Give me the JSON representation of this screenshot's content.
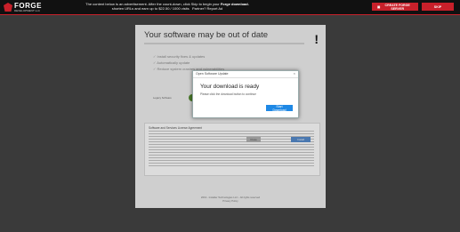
{
  "topbar": {
    "logo_main": "FORGE",
    "logo_sub": "DEVELOPMENT LLC",
    "ad_line1_pre": "The content below is an advertisement. After the count-down, click Skip to begin your ",
    "ad_line1_bold": "Forge download.",
    "ad_line2": "shorten URLs and earn up to $22.50 / 1000 visits",
    "ad_line2_right": "Partner? Report Ad",
    "create_label": "CREATE FORGE SERVER",
    "skip_label": "SKIP"
  },
  "page": {
    "title": "Your software may be out of date",
    "bullets": [
      "Install security fixes & updates",
      "Automatically update",
      "Reduce system crashes and vulnerabilities"
    ],
    "legacy_label": "Legacy Software",
    "license_title": "Software and Services License Agreement",
    "close_label": "Close",
    "install_label": "Install",
    "footer_line1": "2019 - Installer Technologies LLC - All rights reserved",
    "footer_line2": "Privacy Policy"
  },
  "modal": {
    "title": "Open Software Update",
    "close": "×",
    "heading": "Your download is ready",
    "text": "Please click the download button to continue",
    "start_label": "Start Download"
  }
}
